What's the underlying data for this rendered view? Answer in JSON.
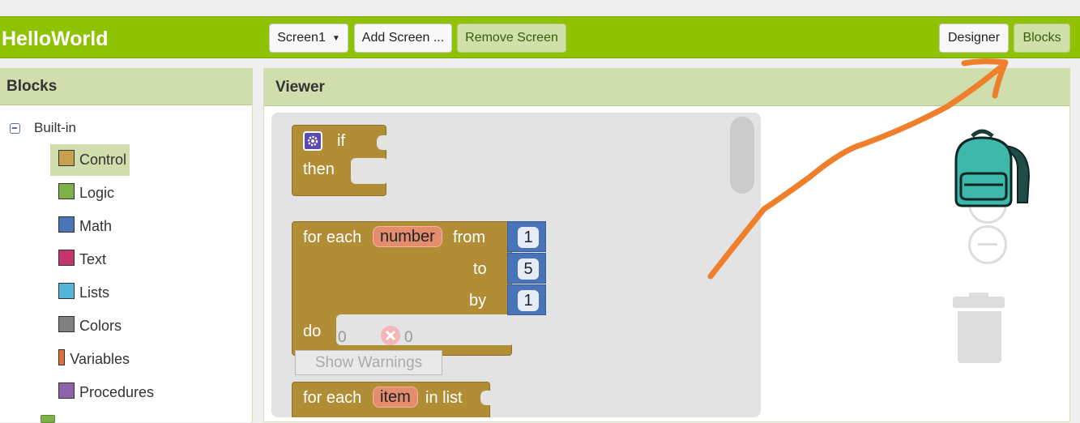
{
  "app": {
    "title": "HelloWorld"
  },
  "toolbar": {
    "screen_select": "Screen1",
    "add_screen": "Add Screen ...",
    "remove_screen": "Remove Screen",
    "designer": "Designer",
    "blocks": "Blocks"
  },
  "blocks_panel": {
    "title": "Blocks",
    "root_label": "Built-in",
    "categories": [
      {
        "label": "Control",
        "color": "#c5a24b"
      },
      {
        "label": "Logic",
        "color": "#7fb14a"
      },
      {
        "label": "Math",
        "color": "#4a74b8"
      },
      {
        "label": "Text",
        "color": "#c5346a"
      },
      {
        "label": "Lists",
        "color": "#55b6d9"
      },
      {
        "label": "Colors",
        "color": "#808080"
      },
      {
        "label": "Variables",
        "color": "#e0703a"
      },
      {
        "label": "Procedures",
        "color": "#8e64a8"
      }
    ]
  },
  "viewer": {
    "title": "Viewer",
    "if_block": {
      "if": "if",
      "then": "then"
    },
    "for_range_block": {
      "for_each": "for each",
      "variable": "number",
      "from": "from",
      "to": "to",
      "by": "by",
      "do": "do",
      "from_value": "1",
      "to_value": "5",
      "by_value": "1"
    },
    "for_list_block": {
      "for_each": "for each",
      "variable": "item",
      "in_list": "in list"
    },
    "warnings": {
      "warning_count": "0",
      "error_count": "0",
      "show_warnings": "Show Warnings"
    }
  },
  "colors": {
    "topbar": "#8fc202",
    "control_block": "#b18e35",
    "math_block": "#4a74b8",
    "annotation_arrow": "#f07f2c"
  }
}
